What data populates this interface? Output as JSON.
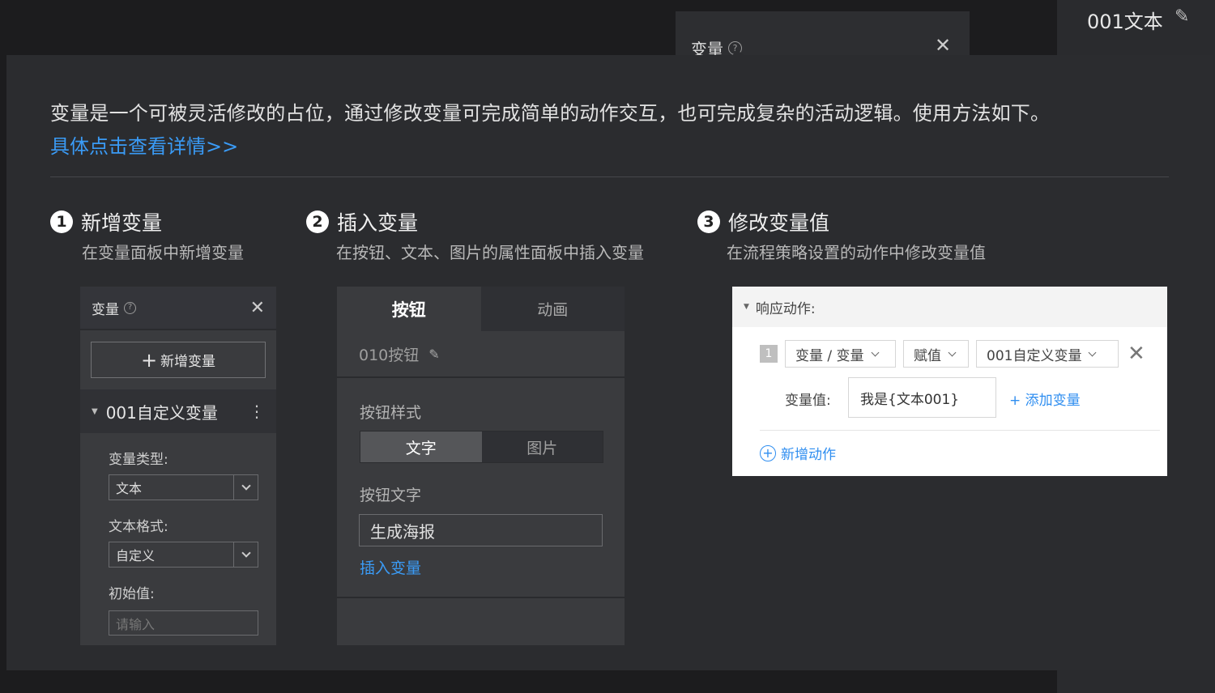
{
  "background": {
    "panel_title": "变量",
    "panel_close": "✕",
    "right_name": "001文本",
    "right_edit": "✎"
  },
  "intro": {
    "text": "变量是一个可被灵活修改的占位，通过修改变量可完成简单的动作交互，也可完成复杂的活动逻辑。使用方法如下。",
    "link": "具体点击查看详情>>"
  },
  "steps": [
    {
      "num": "1",
      "title": "新增变量",
      "desc": "在变量面板中新增变量"
    },
    {
      "num": "2",
      "title": "插入变量",
      "desc": "在按钮、文本、图片的属性面板中插入变量"
    },
    {
      "num": "3",
      "title": "修改变量值",
      "desc": "在流程策略设置的动作中修改变量值"
    }
  ],
  "mock1": {
    "title": "变量",
    "close": "✕",
    "add_button": "新增变量",
    "var_name": "001自定义变量",
    "type_label": "变量类型:",
    "type_value": "文本",
    "format_label": "文本格式:",
    "format_value": "自定义",
    "init_label": "初始值:",
    "init_placeholder": "请输入"
  },
  "mock2": {
    "tabs": [
      "按钮",
      "动画"
    ],
    "name": "010按钮",
    "style_label": "按钮样式",
    "style_options": [
      "文字",
      "图片"
    ],
    "text_label": "按钮文字",
    "text_value": "生成海报",
    "insert_link": "插入变量"
  },
  "mock3": {
    "header": "响应动作:",
    "index": "1",
    "action_select": "变量 / 变量",
    "op_select": "赋值",
    "target_select": "001自定义变量",
    "value_label": "变量值:",
    "value": "我是{文本001}",
    "add_variable": "添加变量",
    "new_action": "新增动作"
  },
  "colors": {
    "accent": "#3a9bf6",
    "modal_bg": "#2b2c2f",
    "page_bg": "#1c1c1e"
  }
}
